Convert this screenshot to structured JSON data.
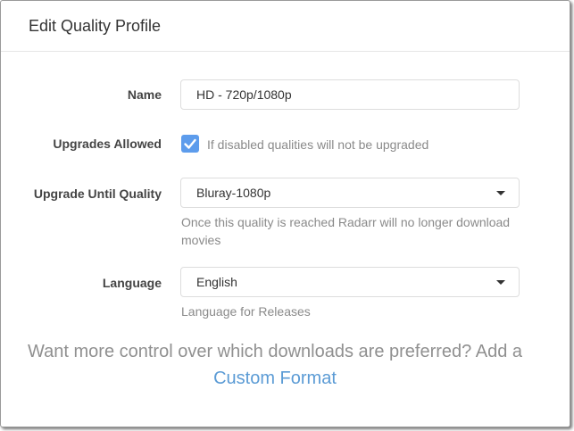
{
  "modal": {
    "title": "Edit Quality Profile"
  },
  "form": {
    "name": {
      "label": "Name",
      "value": "HD - 720p/1080p"
    },
    "upgrades_allowed": {
      "label": "Upgrades Allowed",
      "checked": true,
      "help": "If disabled qualities will not be upgraded"
    },
    "upgrade_until": {
      "label": "Upgrade Until Quality",
      "value": "Bluray-1080p",
      "help": "Once this quality is reached Radarr will no longer download movies"
    },
    "language": {
      "label": "Language",
      "value": "English",
      "help": "Language for Releases"
    }
  },
  "footer": {
    "text": "Want more control over which downloads are preferred? Add a",
    "link_text": "Custom Format"
  },
  "colors": {
    "checkbox": "#5d9cec",
    "link": "#5b9bd5"
  },
  "icons": {
    "checkbox": "checkmark-icon",
    "select": "caret-down-icon"
  }
}
